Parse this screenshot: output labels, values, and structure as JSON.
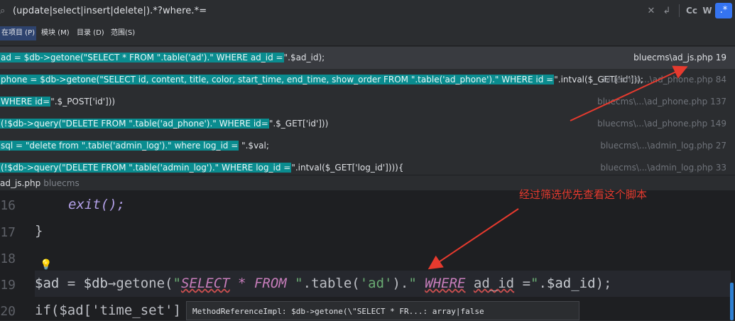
{
  "search": {
    "query": "(update|select|insert|delete|).*?where.*=",
    "icons": [
      "search-icon",
      "clear-icon",
      "replace-icon",
      "match-case-icon",
      "whole-word-icon",
      "regex-icon"
    ],
    "opt_case": "Cc",
    "opt_word": "W"
  },
  "scopes": [
    {
      "label": "在项目 (P)",
      "active": true
    },
    {
      "label": "模块 (M)",
      "active": false
    },
    {
      "label": "目录 (D)",
      "active": false
    },
    {
      "label": "范围(S)",
      "active": false
    }
  ],
  "results": [
    {
      "pre": "",
      "hl": "ad = $db->getone(\"SELECT * FROM \".table('ad').\" WHERE ad_id =",
      "post": "\".$ad_id);",
      "file": "bluecms\\ad_js.php 19",
      "selected": true
    },
    {
      "pre": "",
      "hl": "phone = $db->getone(\"SELECT id, content, title, color, start_time, end_time, show_order FROM \".table('ad_phone').\" WHERE id =",
      "post": "\".intval($_GET['id']));",
      "file": "bluecms\\...\\ad_phone.php 84",
      "selected": false
    },
    {
      "pre": "",
      "hl": "WHERE id=",
      "post": "\".$_POST['id']))",
      "file": "bluecms\\...\\ad_phone.php 137",
      "selected": false
    },
    {
      "pre": "",
      "hl": "(!$db->query(\"DELETE FROM \".table('ad_phone').\" WHERE id=",
      "post": "\".$_GET['id']))",
      "file": "bluecms\\...\\ad_phone.php 149",
      "selected": false
    },
    {
      "pre": "",
      "hl": "sql = \"delete from \".table('admin_log').\" where log_id =",
      "post": " \".$val;",
      "file": "bluecms\\...\\admin_log.php 27",
      "selected": false
    },
    {
      "pre": "",
      "hl": "(!$db->query(\"DELETE FROM \".table('admin_log').\" WHERE log_id =",
      "post": "\".intval($_GET['log_id']))){",
      "file": "bluecms\\...\\admin_log.php 33",
      "selected": false
    }
  ],
  "breadcrumb": {
    "file": "ad_js.php",
    "project": "bluecms"
  },
  "editor": {
    "line_numbers": [
      "16",
      "17",
      "18",
      "19",
      "20"
    ],
    "lines": {
      "l16": "exit();",
      "l17": "}",
      "l20a": "if($ad['time_set']"
    }
  },
  "tooltip": "MethodReferenceImpl: $db->getone(\\\"SELECT * FR...: array|false",
  "annotation": "经过筛选优先查看这个脚本",
  "colors": {
    "accent": "#3574f0",
    "highlight": "#0a8c8f",
    "annotation": "#e63a2e"
  }
}
